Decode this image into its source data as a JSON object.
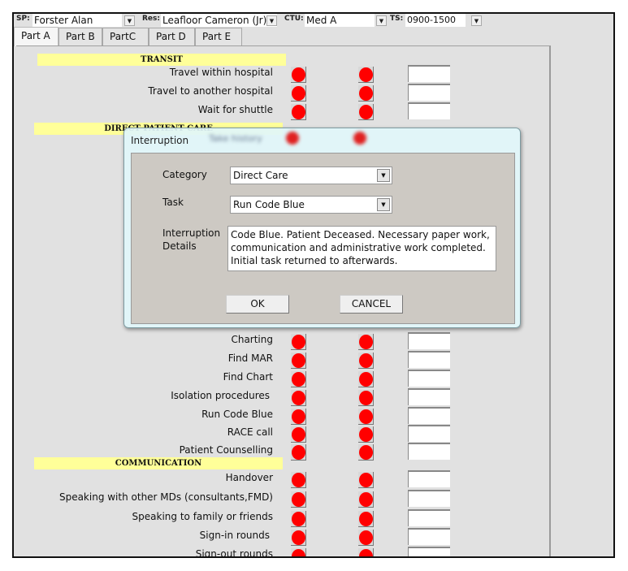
{
  "selectors": {
    "sp": {
      "label": "SP:",
      "value": "Forster Alan"
    },
    "res": {
      "label": "Res:",
      "value": "Leafloor Cameron (Jr)"
    },
    "ctu": {
      "label": "CTU:",
      "value": "Med A"
    },
    "ts": {
      "label": "TS:",
      "value": "0900-1500"
    }
  },
  "tabs": [
    {
      "label": "Part A",
      "active": true
    },
    {
      "label": "Part B",
      "active": false
    },
    {
      "label": "PartC",
      "active": false
    },
    {
      "label": "Part D",
      "active": false
    },
    {
      "label": "Part E",
      "active": false
    }
  ],
  "sections": {
    "transit": {
      "title": "TRANSIT",
      "items": [
        "Travel within hospital",
        "Travel to another hospital",
        "Wait for shuttle"
      ]
    },
    "direct_patient_care": {
      "title": "DIRECT PATIENT CARE",
      "items_hidden_first": "Take history",
      "items": [
        "Charting",
        "Find MAR",
        "Find Chart",
        "Isolation procedures",
        "Run Code Blue",
        "RACE call",
        "Patient Counselling"
      ]
    },
    "communication": {
      "title": "COMMUNICATION",
      "items": [
        "Handover",
        "Speaking with other MDs (consultants,FMD)",
        "Speaking to family or friends",
        "Sign-in rounds",
        "Sign-out rounds"
      ]
    }
  },
  "status_color": "#ff0000",
  "dialog": {
    "title": "Interruption",
    "category_label": "Category",
    "category_value": "Direct Care",
    "task_label": "Task",
    "task_value": "Run Code Blue",
    "details_label_1": "Interruption",
    "details_label_2": "Details",
    "details_value": "Code Blue. Patient Deceased. Necessary paper work, communication and administrative work completed. Initial task returned to afterwards.",
    "ok_label": "OK",
    "cancel_label": "CANCEL"
  }
}
